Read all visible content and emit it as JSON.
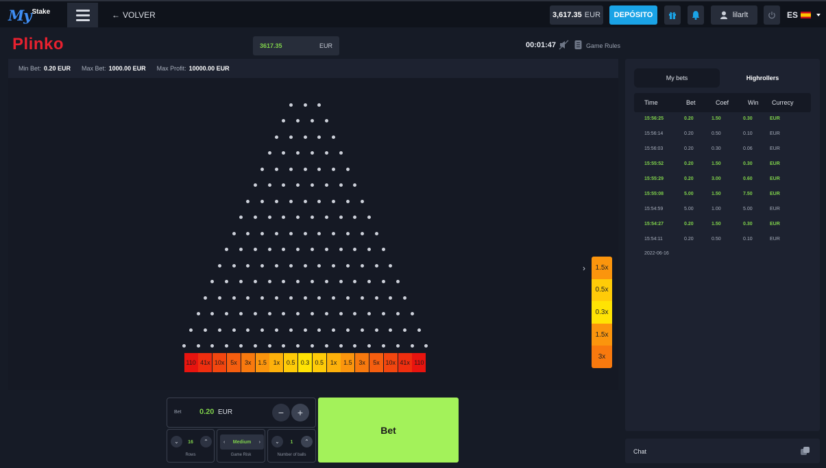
{
  "topbar": {
    "logo_my": "My",
    "logo_stake": "Stake",
    "back_label": "VOLVER",
    "balance_amount": "3,617.35",
    "balance_currency": "EUR",
    "deposit_label": "DEPÓSITO",
    "username": "lilarlt",
    "language": "ES"
  },
  "game": {
    "title": "Plinko",
    "balance": "3617.35",
    "currency": "EUR",
    "timer": "00:01:47",
    "rules_label": "Game Rules"
  },
  "limits": [
    {
      "label": "Min Bet:",
      "value": "0.20 EUR"
    },
    {
      "label": "Max Bet:",
      "value": "1000.00 EUR"
    },
    {
      "label": "Max Profit:",
      "value": "10000.00 EUR"
    }
  ],
  "board": {
    "rows": 16,
    "slots": [
      {
        "label": "110",
        "color": "#e8140f"
      },
      {
        "label": "41x",
        "color": "#ef2e0f"
      },
      {
        "label": "10x",
        "color": "#f2460f"
      },
      {
        "label": "5x",
        "color": "#f55e0f"
      },
      {
        "label": "3x",
        "color": "#f8790e"
      },
      {
        "label": "1.5",
        "color": "#fb950d"
      },
      {
        "label": "1x",
        "color": "#fdb10b"
      },
      {
        "label": "0.5",
        "color": "#ffcb08"
      },
      {
        "label": "0.3",
        "color": "#ffe304"
      },
      {
        "label": "0.5",
        "color": "#ffcb08"
      },
      {
        "label": "1x",
        "color": "#fdb10b"
      },
      {
        "label": "1.5",
        "color": "#fb950d"
      },
      {
        "label": "3x",
        "color": "#f8790e"
      },
      {
        "label": "5x",
        "color": "#f55e0f"
      },
      {
        "label": "10x",
        "color": "#f2460f"
      },
      {
        "label": "41x",
        "color": "#ef2e0f"
      },
      {
        "label": "110",
        "color": "#e8140f"
      }
    ],
    "history": [
      {
        "label": "1.5x",
        "color": "#fb950d"
      },
      {
        "label": "0.5x",
        "color": "#ffcb08"
      },
      {
        "label": "0.3x",
        "color": "#ffe304"
      },
      {
        "label": "1.5x",
        "color": "#fb950d"
      },
      {
        "label": "3x",
        "color": "#f8790e"
      }
    ]
  },
  "controls": {
    "bet_label": "Bet",
    "bet_value": "0.20",
    "bet_currency": "EUR",
    "minus": "−",
    "plus": "+",
    "rows_value": "16",
    "rows_label": "Rows",
    "risk_value": "Medium",
    "risk_label": "Game Risk",
    "balls_value": "1",
    "balls_label": "Number of balls",
    "bet_button": "Bet"
  },
  "sidebar": {
    "tabs": [
      "My bets",
      "Highrollers"
    ],
    "columns": [
      "Time",
      "Bet",
      "Coef",
      "Win",
      "Currecy"
    ],
    "rows": [
      {
        "time": "15:56:25",
        "bet": "0.20",
        "coef": "1.50",
        "win": "0.30",
        "cur": "EUR",
        "won": true
      },
      {
        "time": "15:56:14",
        "bet": "0.20",
        "coef": "0.50",
        "win": "0.10",
        "cur": "EUR",
        "won": false
      },
      {
        "time": "15:56:03",
        "bet": "0.20",
        "coef": "0.30",
        "win": "0.06",
        "cur": "EUR",
        "won": false
      },
      {
        "time": "15:55:52",
        "bet": "0.20",
        "coef": "1.50",
        "win": "0.30",
        "cur": "EUR",
        "won": true
      },
      {
        "time": "15:55:29",
        "bet": "0.20",
        "coef": "3.00",
        "win": "0.60",
        "cur": "EUR",
        "won": true
      },
      {
        "time": "15:55:08",
        "bet": "5.00",
        "coef": "1.50",
        "win": "7.50",
        "cur": "EUR",
        "won": true
      },
      {
        "time": "15:54:59",
        "bet": "5.00",
        "coef": "1.00",
        "win": "5.00",
        "cur": "EUR",
        "won": false
      },
      {
        "time": "15:54:27",
        "bet": "0.20",
        "coef": "1.50",
        "win": "0.30",
        "cur": "EUR",
        "won": true
      },
      {
        "time": "15:54:11",
        "bet": "0.20",
        "coef": "0.50",
        "win": "0.10",
        "cur": "EUR",
        "won": false
      }
    ],
    "date": "2022-06-16",
    "chat_label": "Chat"
  },
  "colors": {
    "accent_green": "#a3f25a",
    "win_green": "#7fd14b",
    "deposit_blue": "#1aa3e6",
    "title_red": "#e8212f"
  }
}
